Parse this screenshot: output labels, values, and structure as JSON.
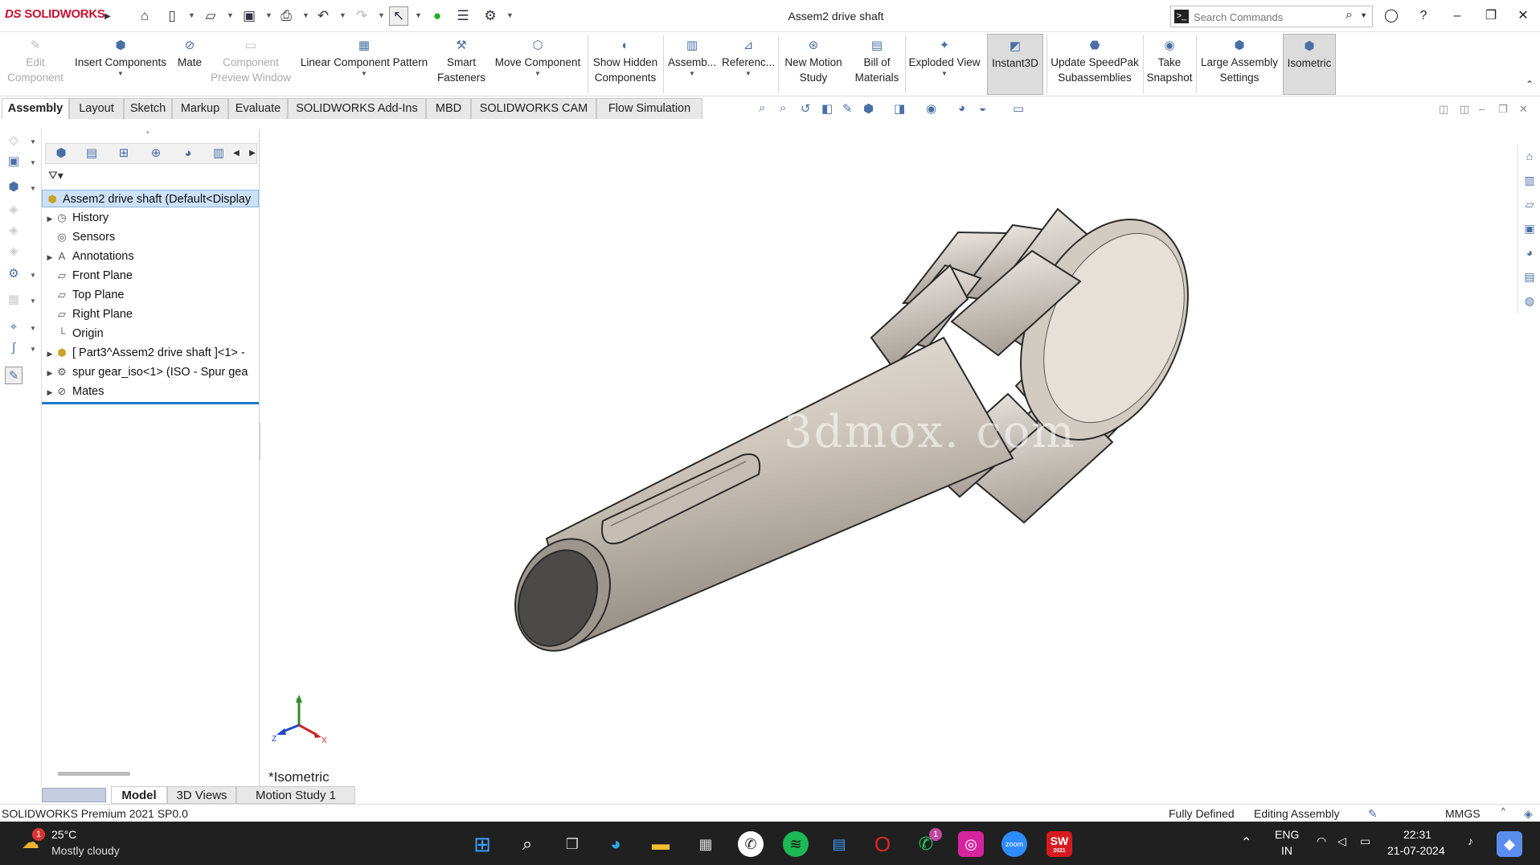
{
  "app": {
    "brand": "SOLIDWORKS",
    "brand_mark": "DS",
    "document_title": "Assem2 drive shaft",
    "search_placeholder": "Search Commands"
  },
  "ribbon": {
    "edit_component": [
      "Edit",
      "Component"
    ],
    "insert_components": "Insert Components",
    "mate": "Mate",
    "component_preview": [
      "Component",
      "Preview Window"
    ],
    "linear_pattern": "Linear Component Pattern",
    "smart_fasteners": [
      "Smart",
      "Fasteners"
    ],
    "move_component": "Move Component",
    "show_hidden": [
      "Show Hidden",
      "Components"
    ],
    "assembly": "Assemb...",
    "reference": "Referenc...",
    "new_motion": [
      "New Motion",
      "Study"
    ],
    "bom": [
      "Bill of",
      "Materials"
    ],
    "exploded": "Exploded View",
    "instant3d": "Instant3D",
    "speedpak": [
      "Update SpeedPak",
      "Subassemblies"
    ],
    "snapshot": [
      "Take",
      "Snapshot"
    ],
    "large_assembly": [
      "Large Assembly",
      "Settings"
    ],
    "isometric": "Isometric"
  },
  "tabs": [
    "Assembly",
    "Layout",
    "Sketch",
    "Markup",
    "Evaluate",
    "SOLIDWORKS Add-Ins",
    "MBD",
    "SOLIDWORKS CAM",
    "Flow Simulation"
  ],
  "tree": {
    "root": "Assem2 drive shaft  (Default<Display",
    "items": [
      {
        "label": "History"
      },
      {
        "label": "Sensors"
      },
      {
        "label": "Annotations"
      },
      {
        "label": "Front Plane"
      },
      {
        "label": "Top Plane"
      },
      {
        "label": "Right Plane"
      },
      {
        "label": "Origin"
      },
      {
        "label": "[ Part3^Assem2 drive shaft ]<1> -"
      },
      {
        "label": "spur gear_iso<1> (ISO - Spur gea"
      },
      {
        "label": "Mates"
      }
    ]
  },
  "viewport": {
    "view_name": "*Isometric",
    "watermark": "3dmox. com",
    "triad": {
      "x": "X",
      "y": "Y",
      "z": "Z"
    }
  },
  "bottom_tabs": [
    "Model",
    "3D Views",
    "Motion Study 1"
  ],
  "status": {
    "version": "SOLIDWORKS Premium 2021 SP0.0",
    "defined": "Fully Defined",
    "mode": "Editing Assembly",
    "units": "MMGS",
    "units_caret": "^"
  },
  "taskbar": {
    "weather_temp": "25°C",
    "weather_desc": "Mostly cloudy",
    "weather_badge": "1",
    "whatsapp_badge": "1",
    "lang": "ENG",
    "region": "IN",
    "time": "22:31",
    "date": "21-07-2024",
    "zoom_label": "zoom",
    "sw_label": "SW",
    "sw_year": "2021"
  }
}
